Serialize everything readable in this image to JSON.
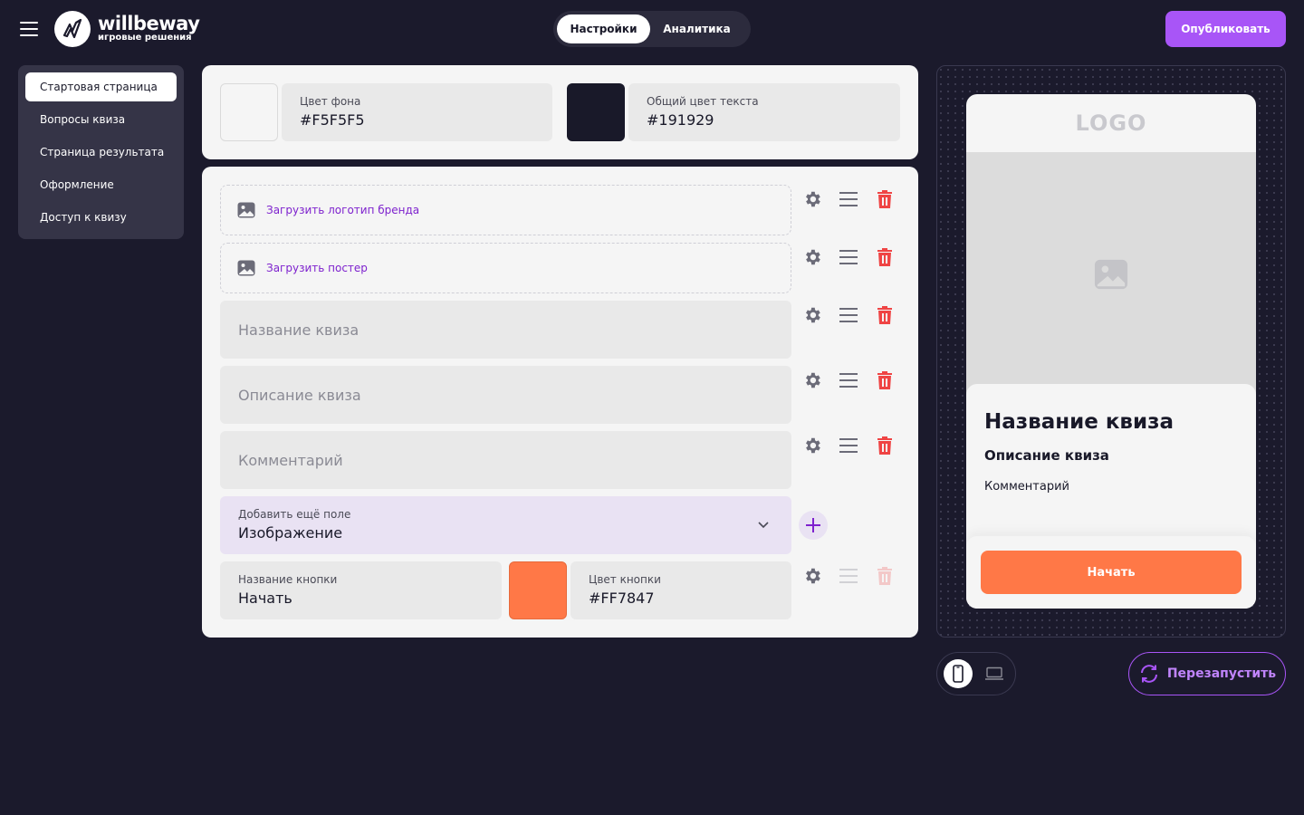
{
  "header": {
    "brand_name": "willbeway",
    "brand_sub": "игровые решения",
    "tabs": [
      {
        "label": "Настройки",
        "active": true
      },
      {
        "label": "Аналитика",
        "active": false
      }
    ],
    "publish_label": "Опубликовать"
  },
  "sidebar": {
    "items": [
      {
        "label": "Стартовая страница",
        "active": true
      },
      {
        "label": "Вопросы квиза"
      },
      {
        "label": "Страница результата"
      },
      {
        "label": "Оформление"
      },
      {
        "label": "Доступ к квизу"
      }
    ]
  },
  "colors": {
    "background": {
      "label": "Цвет фона",
      "value": "#F5F5F5"
    },
    "text": {
      "label": "Общий цвет текста",
      "value": "#191929"
    }
  },
  "fields": {
    "upload_logo": "Загрузить логотип бренда",
    "upload_poster": "Загрузить постер",
    "quiz_title_placeholder": "Название квиза",
    "quiz_desc_placeholder": "Описание квиза",
    "comment_placeholder": "Комментарий",
    "add_field": {
      "label": "Добавить ещё поле",
      "value": "Изображение"
    },
    "button_name": {
      "label": "Название кнопки",
      "value": "Начать"
    },
    "button_color": {
      "label": "Цвет кнопки",
      "value": "#FF7847"
    }
  },
  "preview": {
    "logo": "LOGO",
    "title": "Название квиза",
    "description": "Описание квиза",
    "comment": "Комментарий",
    "start_label": "Начать"
  },
  "controls": {
    "restart_label": "Перезапустить"
  },
  "theme": {
    "accent": "#A855F7",
    "danger": "#EF4444",
    "button": "#FF7847",
    "bg_dark": "#1B1A2C"
  }
}
